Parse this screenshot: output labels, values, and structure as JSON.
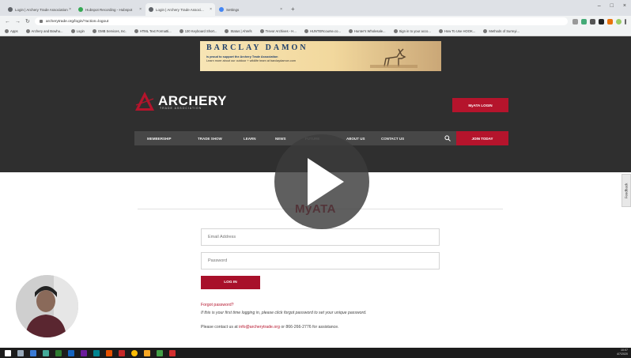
{
  "browser": {
    "tabs": [
      {
        "label": "Login | Archery Trade Association",
        "active": false
      },
      {
        "label": "Hubspot Recording - Hubspot",
        "active": false
      },
      {
        "label": "Login | Archery Trade Associ...",
        "active": true
      },
      {
        "label": "Settings",
        "active": false
      }
    ],
    "new_tab_symbol": "+",
    "url": "archerytrade.org/login/?action=logout",
    "bookmarks": [
      "Apps",
      "Archery and Bowhu...",
      "Login",
      "GMB Services, Inc.",
      "HTML Text Formatti...",
      "130 Keyboard Short...",
      "Status | Ahrefs",
      "Trevor Archives - H...",
      "HUNTERcourse.co...",
      "Hunter's Wholesale...",
      "Sign in to your acco...",
      "How To Use HOOK...",
      "Methods of Surreyi..."
    ]
  },
  "site": {
    "banner": {
      "brand": "BARCLAY DAMON",
      "tagline": "is proud to support the Archery Trade Association",
      "sub": "Learn more about our outdoor + wildlife team at barclaydamon.com"
    },
    "logo": {
      "word": "ARCHERY",
      "sub": "TRADE ASSOCIATION"
    },
    "myata_login": "MyATA LOGIN",
    "nav": [
      "MEMBERSHIP",
      "TRADE SHOW",
      "LEARN",
      "NEWS",
      "FUTURE",
      "ABOUT US",
      "CONTACT US"
    ],
    "join_today": "JOIN TODAY"
  },
  "login": {
    "title": "MyATA",
    "email_placeholder": "Email Address",
    "password_placeholder": "Password",
    "button": "LOG IN",
    "forgot": "Forgot password?",
    "first_time": "If this is your first time logging in, please click forgot password to set your unique password.",
    "contact_prefix": "Please contact us at ",
    "contact_email": "info@archerytrade.org",
    "contact_suffix": " or 866-266-2776 for assistance."
  },
  "feedback": "Feedback",
  "taskbar": {
    "time": "10:07",
    "date": "4/7/2020"
  },
  "colors": {
    "accent": "#b5142c",
    "header_bg": "#2f2f2f",
    "nav_bg": "#474747"
  }
}
